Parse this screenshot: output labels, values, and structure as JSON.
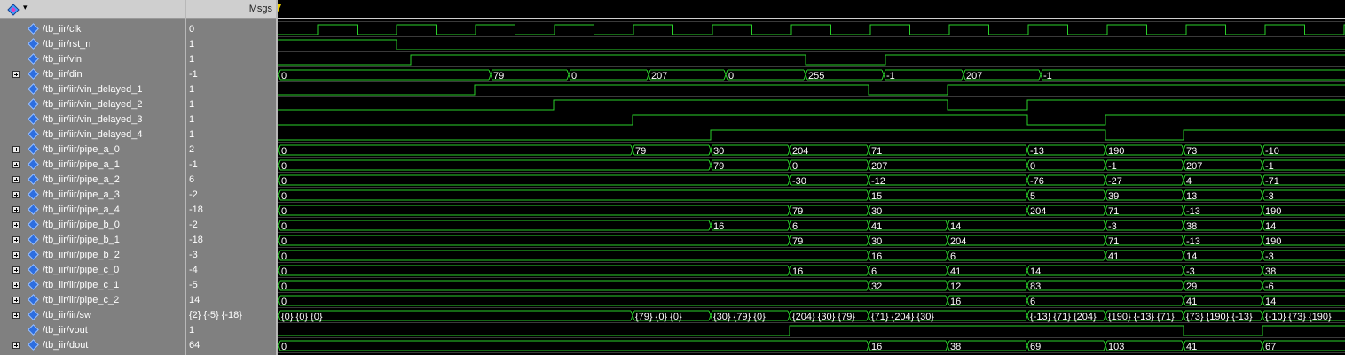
{
  "header": {
    "msgs_label": "Msgs"
  },
  "signals": [
    {
      "name": "/tb_iir/clk",
      "value": "0",
      "expandable": false
    },
    {
      "name": "/tb_iir/rst_n",
      "value": "1",
      "expandable": false
    },
    {
      "name": "/tb_iir/vin",
      "value": "1",
      "expandable": false
    },
    {
      "name": "/tb_iir/din",
      "value": "-1",
      "expandable": true
    },
    {
      "name": "/tb_iir/iir/vin_delayed_1",
      "value": "1",
      "expandable": false
    },
    {
      "name": "/tb_iir/iir/vin_delayed_2",
      "value": "1",
      "expandable": false
    },
    {
      "name": "/tb_iir/iir/vin_delayed_3",
      "value": "1",
      "expandable": false
    },
    {
      "name": "/tb_iir/iir/vin_delayed_4",
      "value": "1",
      "expandable": false
    },
    {
      "name": "/tb_iir/iir/pipe_a_0",
      "value": "2",
      "expandable": true
    },
    {
      "name": "/tb_iir/iir/pipe_a_1",
      "value": "-1",
      "expandable": true
    },
    {
      "name": "/tb_iir/iir/pipe_a_2",
      "value": "6",
      "expandable": true
    },
    {
      "name": "/tb_iir/iir/pipe_a_3",
      "value": "-2",
      "expandable": true
    },
    {
      "name": "/tb_iir/iir/pipe_a_4",
      "value": "-18",
      "expandable": true
    },
    {
      "name": "/tb_iir/iir/pipe_b_0",
      "value": "-2",
      "expandable": true
    },
    {
      "name": "/tb_iir/iir/pipe_b_1",
      "value": "-18",
      "expandable": true
    },
    {
      "name": "/tb_iir/iir/pipe_b_2",
      "value": "-3",
      "expandable": true
    },
    {
      "name": "/tb_iir/iir/pipe_c_0",
      "value": "-4",
      "expandable": true
    },
    {
      "name": "/tb_iir/iir/pipe_c_1",
      "value": "-5",
      "expandable": true
    },
    {
      "name": "/tb_iir/iir/pipe_c_2",
      "value": "14",
      "expandable": true
    },
    {
      "name": "/tb_iir/iir/sw",
      "value": "{2} {-5} {-18}",
      "expandable": true
    },
    {
      "name": "/tb_iir/vout",
      "value": "1",
      "expandable": false
    },
    {
      "name": "/tb_iir/dout",
      "value": "64",
      "expandable": true
    }
  ],
  "waves": [
    {
      "type": "clk",
      "period": 89,
      "start": 1,
      "first_high": 45
    },
    {
      "type": "bit",
      "init": 1,
      "toggles": [
        134
      ]
    },
    {
      "type": "bit",
      "init": 0,
      "toggles": [
        150,
        595,
        685
      ]
    },
    {
      "type": "bus",
      "segments": [
        [
          1,
          "0"
        ],
        [
          240,
          "79"
        ],
        [
          328,
          "0"
        ],
        [
          418,
          "207"
        ],
        [
          505,
          "0"
        ],
        [
          595,
          "255"
        ],
        [
          683,
          "-1"
        ],
        [
          773,
          "207"
        ],
        [
          860,
          "-1"
        ]
      ]
    },
    {
      "type": "bit",
      "init": 0,
      "toggles": [
        222,
        666,
        755
      ]
    },
    {
      "type": "bit",
      "init": 0,
      "toggles": [
        311,
        755,
        845
      ]
    },
    {
      "type": "bit",
      "init": 0,
      "toggles": [
        400,
        845,
        933
      ]
    },
    {
      "type": "bit",
      "init": 0,
      "toggles": [
        488,
        933,
        1021
      ]
    },
    {
      "type": "bus",
      "segments": [
        [
          1,
          "0"
        ],
        [
          400,
          "79"
        ],
        [
          488,
          "30"
        ],
        [
          577,
          "204"
        ],
        [
          666,
          "71"
        ],
        [
          845,
          "-13"
        ],
        [
          933,
          "190"
        ],
        [
          1021,
          "73"
        ],
        [
          1110,
          "-10"
        ]
      ]
    },
    {
      "type": "bus",
      "segments": [
        [
          1,
          "0"
        ],
        [
          488,
          "79"
        ],
        [
          577,
          "0"
        ],
        [
          666,
          "207"
        ],
        [
          845,
          "0"
        ],
        [
          933,
          "-1"
        ],
        [
          1021,
          "207"
        ],
        [
          1110,
          "-1"
        ]
      ]
    },
    {
      "type": "bus",
      "segments": [
        [
          1,
          "0"
        ],
        [
          577,
          "-30"
        ],
        [
          666,
          "-12"
        ],
        [
          845,
          "-76"
        ],
        [
          933,
          "-27"
        ],
        [
          1021,
          "4"
        ],
        [
          1110,
          "-71"
        ]
      ]
    },
    {
      "type": "bus",
      "segments": [
        [
          1,
          "0"
        ],
        [
          666,
          "15"
        ],
        [
          845,
          "5"
        ],
        [
          933,
          "39"
        ],
        [
          1021,
          "13"
        ],
        [
          1110,
          "-3"
        ]
      ]
    },
    {
      "type": "bus",
      "segments": [
        [
          1,
          "0"
        ],
        [
          577,
          "79"
        ],
        [
          666,
          "30"
        ],
        [
          845,
          "204"
        ],
        [
          933,
          "71"
        ],
        [
          1021,
          "-13"
        ],
        [
          1110,
          "190"
        ]
      ]
    },
    {
      "type": "bus",
      "segments": [
        [
          1,
          "0"
        ],
        [
          488,
          "16"
        ],
        [
          577,
          "6"
        ],
        [
          666,
          "41"
        ],
        [
          755,
          "14"
        ],
        [
          933,
          "-3"
        ],
        [
          1021,
          "38"
        ],
        [
          1110,
          "14"
        ]
      ]
    },
    {
      "type": "bus",
      "segments": [
        [
          1,
          "0"
        ],
        [
          577,
          "79"
        ],
        [
          666,
          "30"
        ],
        [
          755,
          "204"
        ],
        [
          933,
          "71"
        ],
        [
          1021,
          "-13"
        ],
        [
          1110,
          "190"
        ]
      ]
    },
    {
      "type": "bus",
      "segments": [
        [
          1,
          "0"
        ],
        [
          666,
          "16"
        ],
        [
          755,
          "6"
        ],
        [
          933,
          "41"
        ],
        [
          1021,
          "14"
        ],
        [
          1110,
          "-3"
        ]
      ]
    },
    {
      "type": "bus",
      "segments": [
        [
          1,
          "0"
        ],
        [
          577,
          "16"
        ],
        [
          666,
          "6"
        ],
        [
          755,
          "41"
        ],
        [
          845,
          "14"
        ],
        [
          1021,
          "-3"
        ],
        [
          1110,
          "38"
        ]
      ]
    },
    {
      "type": "bus",
      "segments": [
        [
          1,
          "0"
        ],
        [
          666,
          "32"
        ],
        [
          755,
          "12"
        ],
        [
          845,
          "83"
        ],
        [
          1021,
          "29"
        ],
        [
          1110,
          "-6"
        ]
      ]
    },
    {
      "type": "bus",
      "segments": [
        [
          1,
          "0"
        ],
        [
          755,
          "16"
        ],
        [
          845,
          "6"
        ],
        [
          1021,
          "41"
        ],
        [
          1110,
          "14"
        ]
      ]
    },
    {
      "type": "bus",
      "segments": [
        [
          1,
          "{0} {0} {0}"
        ],
        [
          400,
          "{79} {0} {0}"
        ],
        [
          488,
          "{30} {79} {0}"
        ],
        [
          577,
          "{204} {30} {79}"
        ],
        [
          666,
          "{71} {204} {30}"
        ],
        [
          845,
          "{-13} {71} {204}"
        ],
        [
          933,
          "{190} {-13} {71}"
        ],
        [
          1021,
          "{73} {190} {-13}"
        ],
        [
          1110,
          "{-10} {73} {190}"
        ]
      ]
    },
    {
      "type": "bit",
      "init": 0,
      "toggles": [
        577,
        1021,
        1110
      ]
    },
    {
      "type": "bus",
      "segments": [
        [
          1,
          "0"
        ],
        [
          666,
          "16"
        ],
        [
          755,
          "38"
        ],
        [
          845,
          "69"
        ],
        [
          933,
          "103"
        ],
        [
          1021,
          "41"
        ],
        [
          1110,
          "67"
        ]
      ]
    }
  ],
  "colors": {
    "wave": "#2ad02a",
    "panel": "#808080",
    "bg": "#000000",
    "icon": "#2d6ee0"
  }
}
